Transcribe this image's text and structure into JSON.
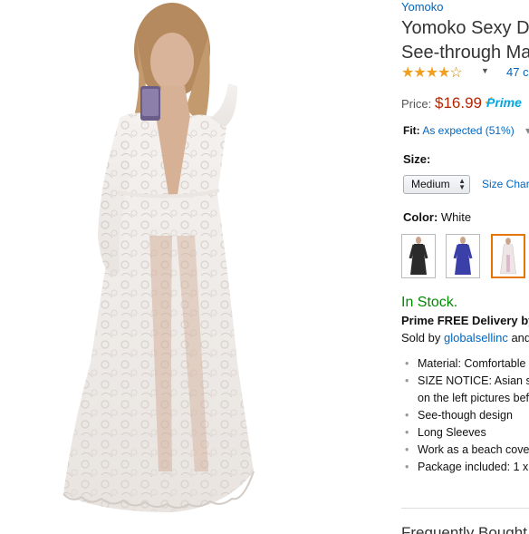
{
  "product": {
    "brand": "Yomoko",
    "title_line1": "Yomoko Sexy D",
    "title_line2": "See-through Ma",
    "rating_stars": 4.0,
    "reviews_link": "47 c",
    "price_label": "Price:",
    "price": "$16.99",
    "prime_label": "Prime",
    "fit_label": "Fit:",
    "fit_value": "As expected (51%)",
    "size_label": "Size:",
    "size_selected": "Medium",
    "size_chart_link": "Size Chart",
    "color_label": "Color:",
    "color_value": "White",
    "swatches": [
      {
        "name": "black-dress",
        "color": "#2b2b2b"
      },
      {
        "name": "blue-dress",
        "color": "#3b3fa8"
      },
      {
        "name": "white-dress",
        "color": "#f2eeee",
        "selected": true
      }
    ],
    "stock": "In Stock.",
    "delivery": "Prime FREE Delivery by",
    "sold_by_prefix": "Sold by",
    "seller": "globalsellinc",
    "sold_by_suffix": "and",
    "bullets": [
      "Material: Comfortable",
      "SIZE NOTICE: Asian s",
      "on the left pictures bef",
      "See-though design",
      "Long Sleeves",
      "Work as a beach cove",
      "Package included: 1 x"
    ],
    "fbt_heading": "Frequently Bought T"
  },
  "colors": {
    "link": "#0066c0",
    "price": "#b12704",
    "instock": "#008a00",
    "star": "#f0a020",
    "prime": "#00a8e1"
  }
}
